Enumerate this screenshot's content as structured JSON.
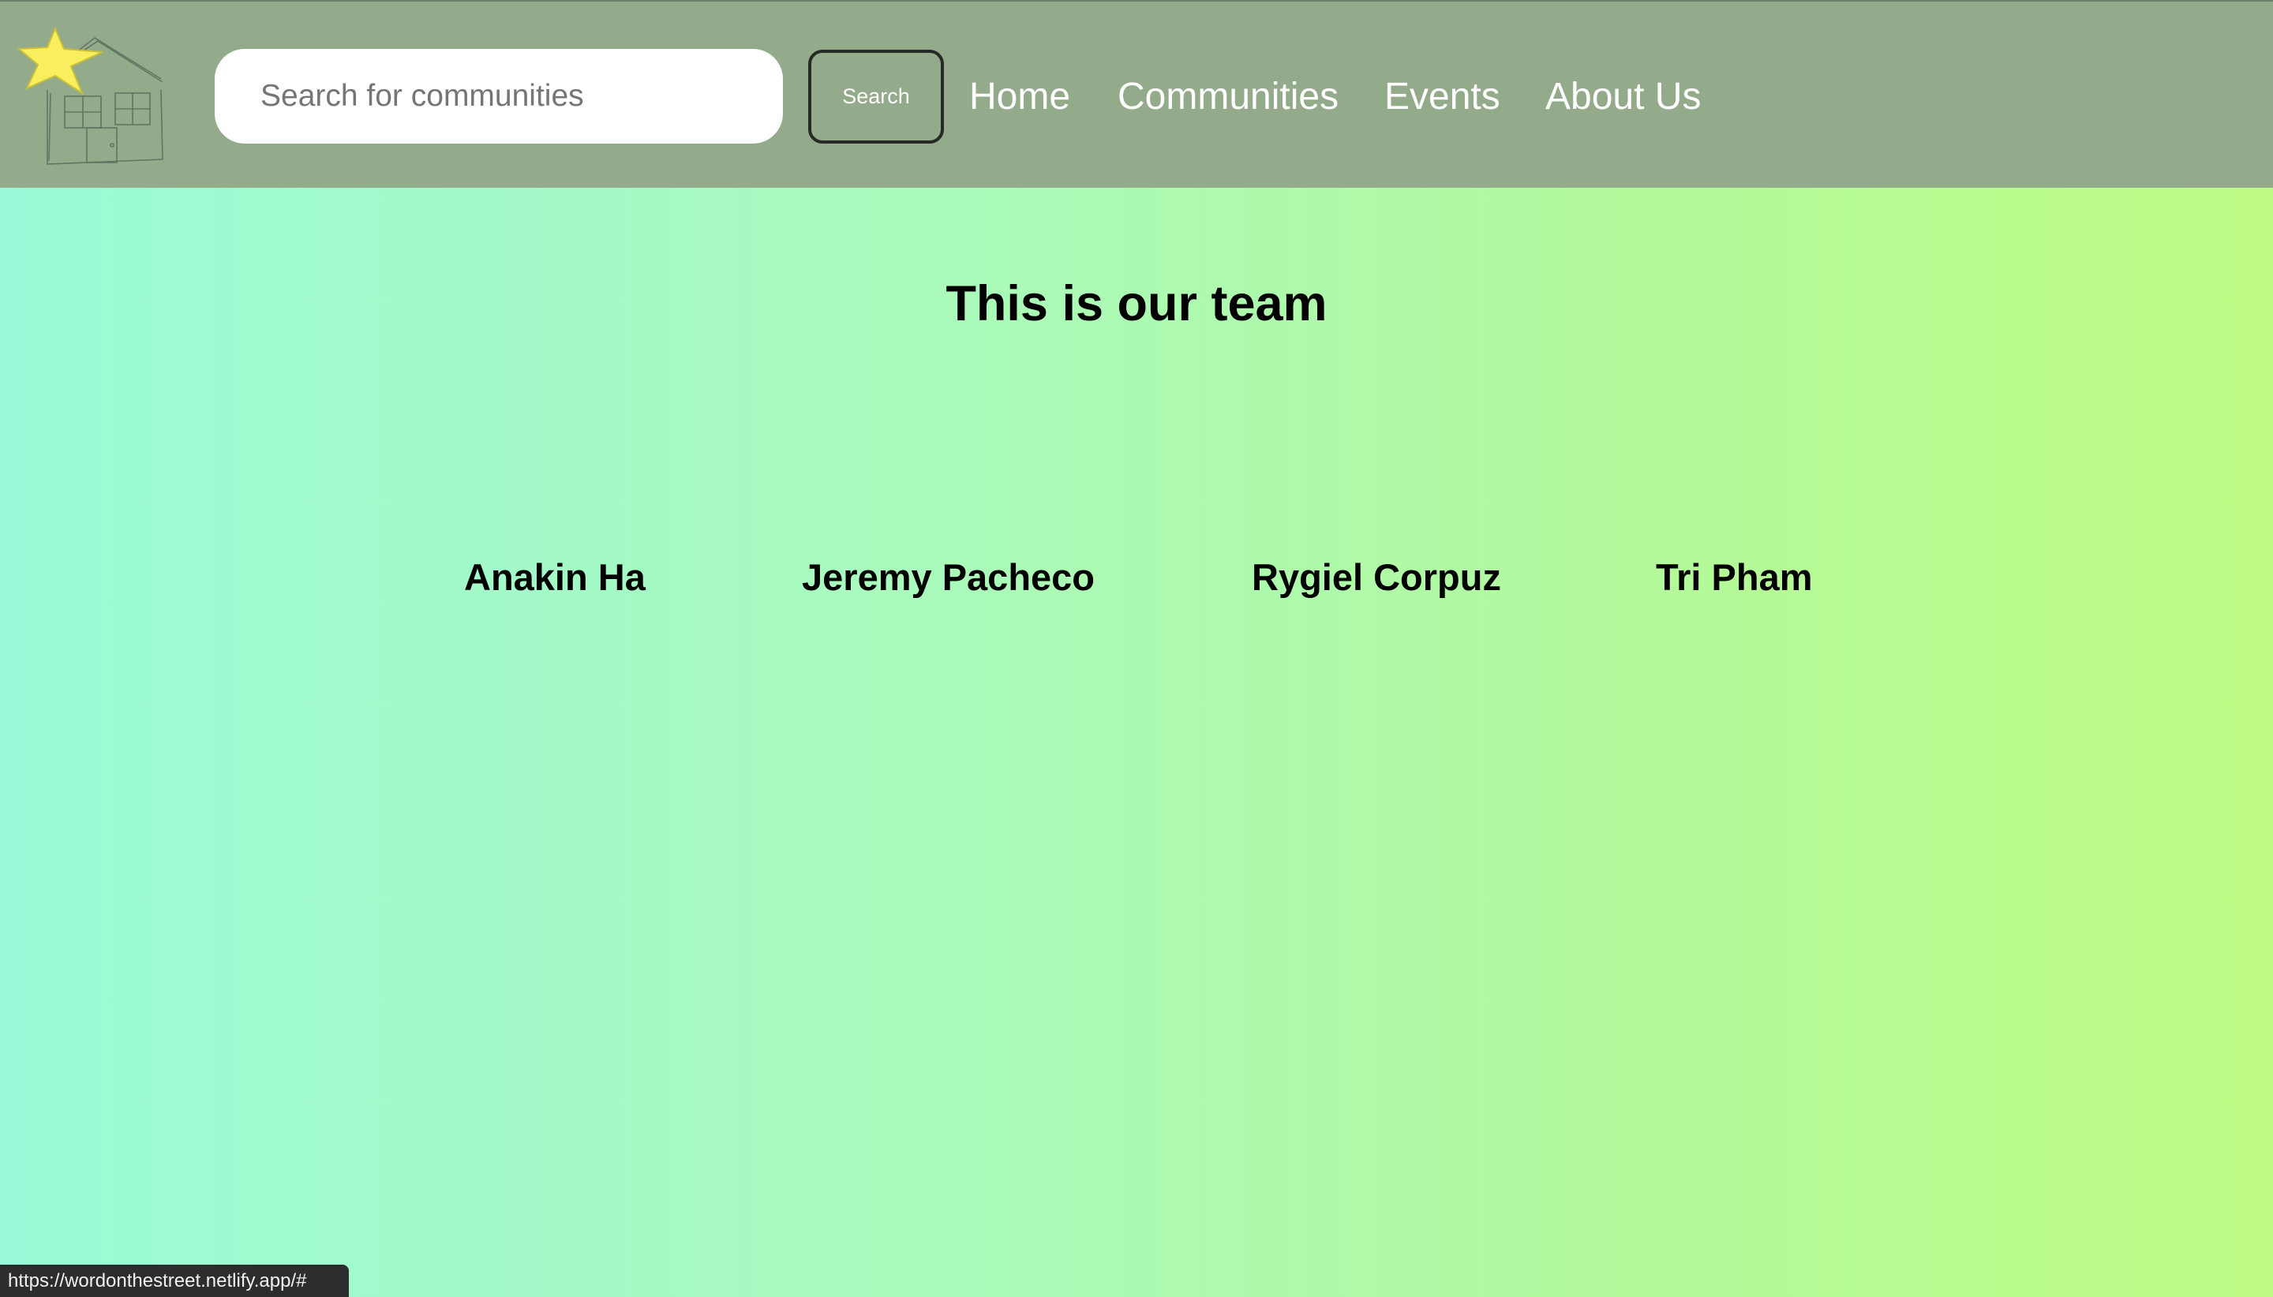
{
  "header": {
    "logo": {
      "icon": "house-with-star-icon",
      "star_color": "#f9ef5e",
      "sketch_color": "#5b6b5c"
    },
    "search": {
      "placeholder": "Search for communities",
      "value": "",
      "button_label": "Search"
    },
    "nav": [
      {
        "label": "Home"
      },
      {
        "label": "Communities"
      },
      {
        "label": "Events"
      },
      {
        "label": "About Us"
      }
    ],
    "background_color": "#93ab8a"
  },
  "main": {
    "title": "This is our team",
    "team": [
      {
        "name": "Anakin Ha"
      },
      {
        "name": "Jeremy Pacheco"
      },
      {
        "name": "Rygiel Corpuz"
      },
      {
        "name": "Tri Pham"
      }
    ],
    "gradient": [
      "#9bfbd8",
      "#befc84"
    ]
  },
  "status_bar": {
    "url": "https://wordonthestreet.netlify.app/#"
  }
}
